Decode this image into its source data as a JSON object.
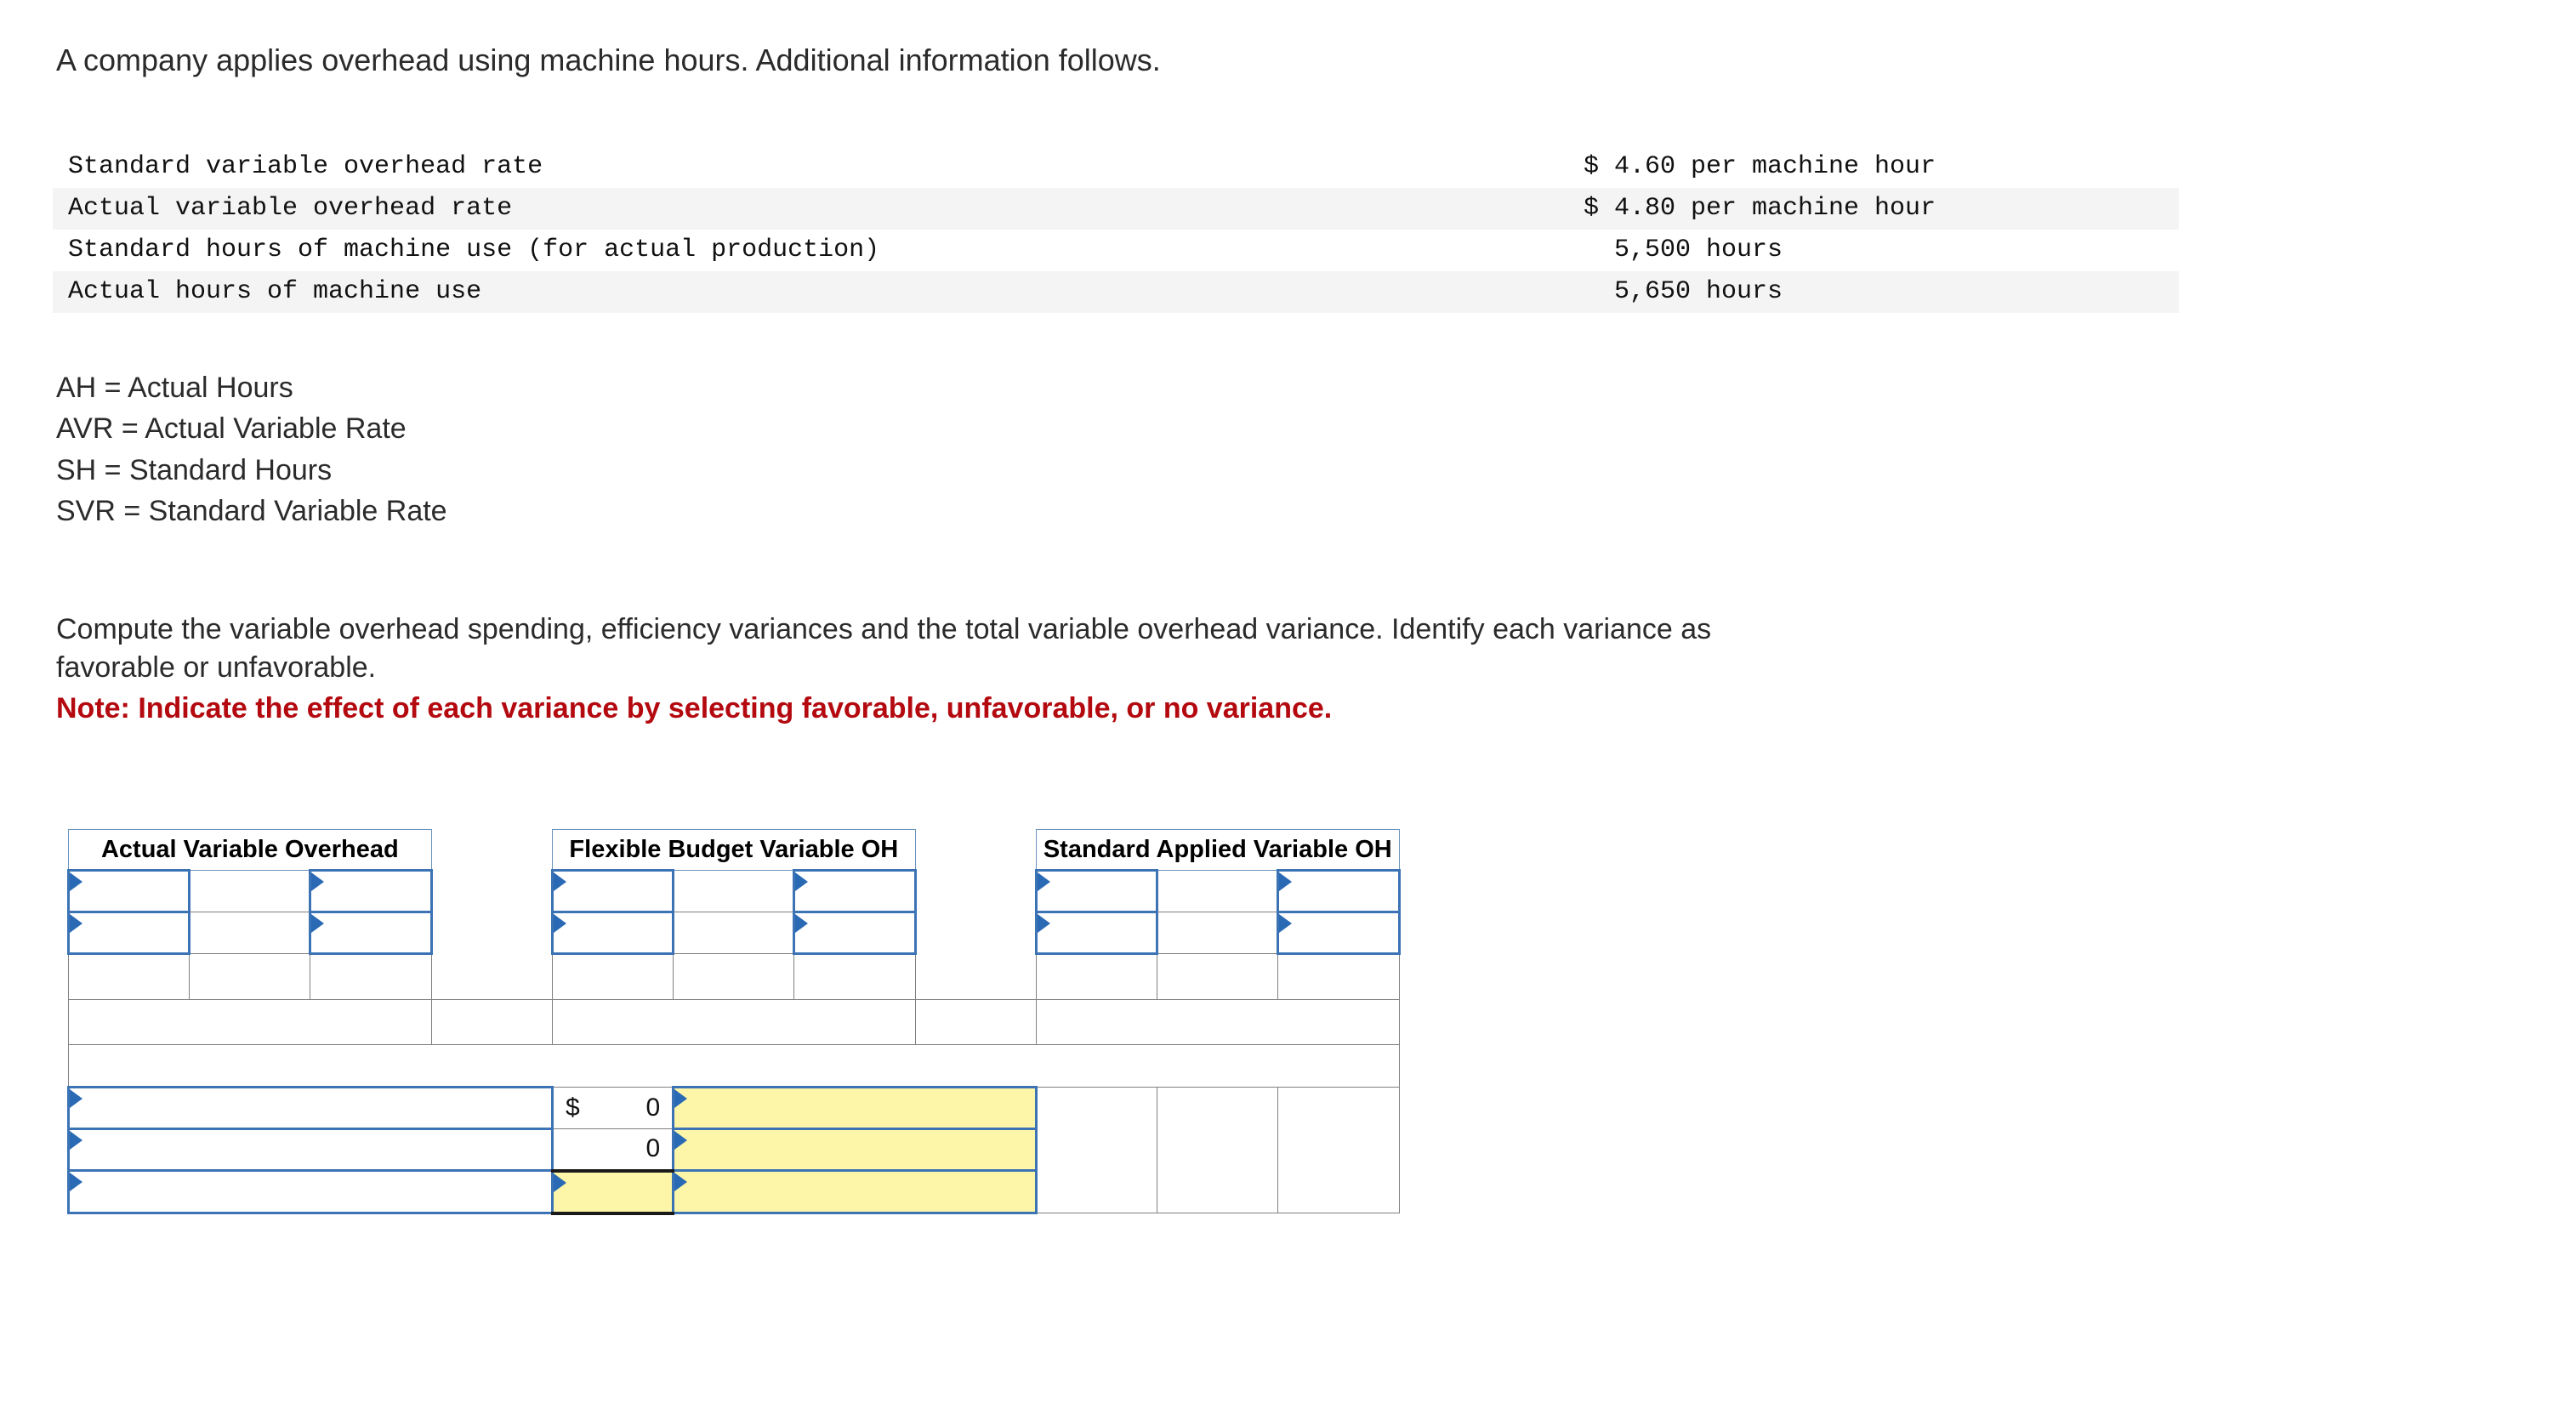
{
  "intro": {
    "text": "A company applies overhead using machine hours. Additional information follows."
  },
  "facts": {
    "rows": [
      {
        "label": "Standard variable overhead rate",
        "value": "$ 4.60 per machine hour"
      },
      {
        "label": "Actual variable overhead rate",
        "value": "$ 4.80 per machine hour"
      },
      {
        "label": "Standard hours of machine use (for actual production)",
        "value": "  5,500 hours"
      },
      {
        "label": "Actual hours of machine use",
        "value": "  5,650 hours"
      }
    ]
  },
  "legend": {
    "lines": [
      "AH = Actual Hours",
      "AVR = Actual Variable Rate",
      "SH = Standard Hours",
      "SVR = Standard Variable Rate"
    ]
  },
  "instructions": {
    "line1": "Compute the variable overhead spending, efficiency variances and the total variable overhead variance. Identify each variance as",
    "line2": "favorable or unfavorable.",
    "note": "Note: Indicate the effect of each variance by selecting favorable, unfavorable, or no variance."
  },
  "grid": {
    "headers": {
      "actual": "Actual Variable Overhead",
      "flexible": "Flexible Budget Variable OH",
      "standard": "Standard Applied Variable OH"
    },
    "bottom": {
      "row1": {
        "currency": "$",
        "amount": "0"
      },
      "row2": {
        "currency": "",
        "amount": "0"
      },
      "row3": {
        "currency": "",
        "amount": ""
      }
    }
  },
  "colors": {
    "header_blue": "#7cb0e0",
    "dropdown_border": "#3c73b4",
    "input_yellow": "#fdf6a8",
    "note_red": "#b3090f",
    "grid_line": "#808080"
  }
}
